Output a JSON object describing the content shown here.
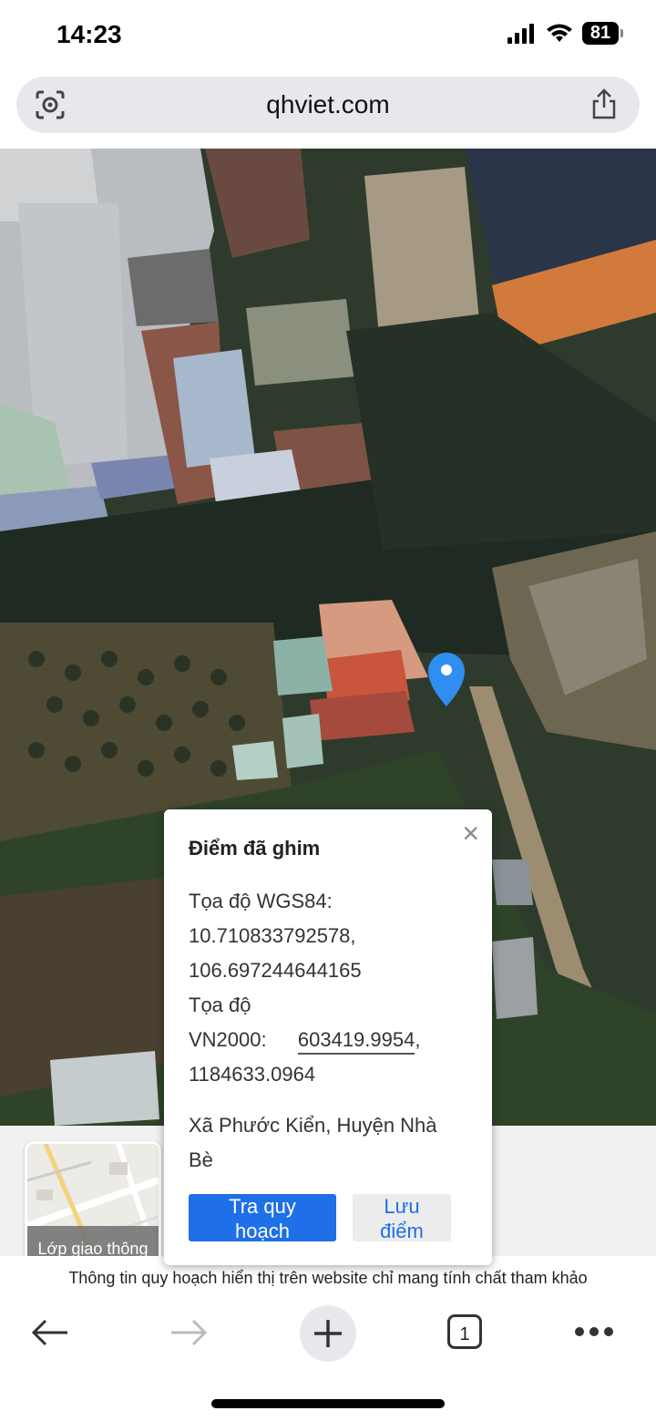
{
  "status": {
    "time": "14:23",
    "battery": "81"
  },
  "browser": {
    "url": "qhviet.com"
  },
  "popup": {
    "title": "Điểm đã ghim",
    "wgs_label": "Tọa độ WGS84:",
    "wgs_lat": "10.710833792578,",
    "wgs_lon": "106.697244644165",
    "vn_label_1": "Tọa độ",
    "vn_label_2": "VN2000:",
    "vn_x": "603419.9954",
    "vn_x_comma": ",",
    "vn_y": "1184633.0964",
    "address_1": "Xã Phước Kiển, Huyện Nhà",
    "address_2": "Bè",
    "btn_plan_1": "Tra quy",
    "btn_plan_2": "hoạch",
    "btn_save_1": "Lưu",
    "btn_save_2": "điểm",
    "close": "×"
  },
  "layer": {
    "label": "Lớp giao thông"
  },
  "disclaimer": "Thông tin quy hoạch hiển thị trên website chỉ mang tính chất tham khảo",
  "toolbar": {
    "tabs_count": "1"
  },
  "colors": {
    "accent": "#1e6fe8",
    "pin": "#2f8ff0"
  }
}
